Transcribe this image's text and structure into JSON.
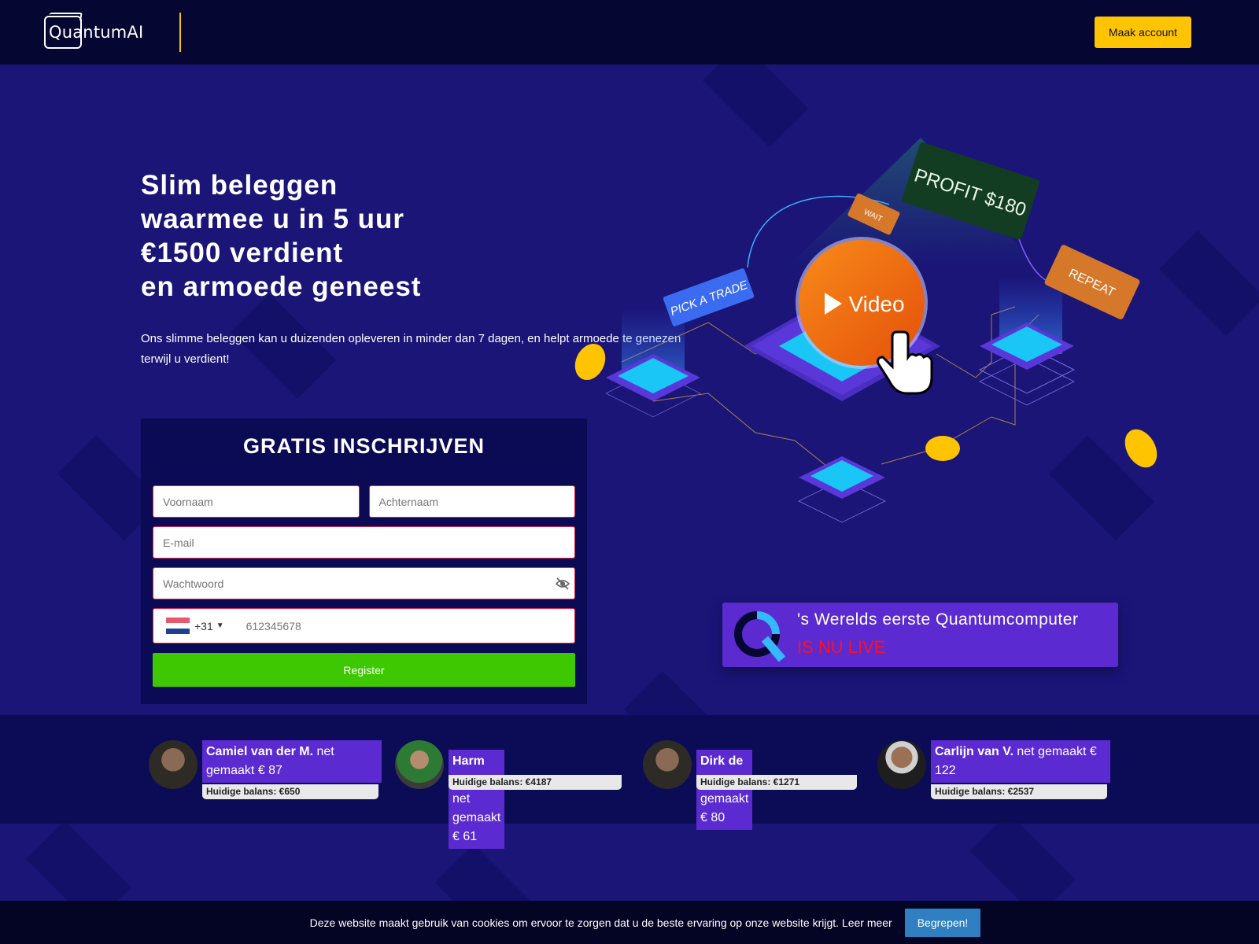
{
  "header": {
    "logo_text": "QuantumAI",
    "cta_label": "Maak account"
  },
  "hero": {
    "title_lines": [
      "Slim beleggen",
      "waarmee u in 5 uur",
      "€1500 verdient",
      "en armoede geneest"
    ],
    "subtitle": "Ons slimme beleggen kan u duizenden opleveren in minder dan 7 dagen, en helpt armoede te genezen terwijl u verdient!"
  },
  "illustration": {
    "video_label": "Video",
    "pick_label": "PICK A TRADE",
    "wait_label": "WAIT",
    "profit_label": "PROFIT $180",
    "repeat_label": "REPEAT"
  },
  "form": {
    "title": "GRATIS INSCHRIJVEN",
    "first_name_placeholder": "Voornaam",
    "last_name_placeholder": "Achternaam",
    "email_placeholder": "E-mail",
    "password_placeholder": "Wachtwoord",
    "phone_code": "+31",
    "phone_placeholder": "612345678",
    "submit_label": "Register"
  },
  "quantum_banner": {
    "line1": "'s Werelds eerste Quantumcomputer",
    "line2": "IS NU LIVE"
  },
  "testimonials": [
    {
      "name": "Camiel van der M.",
      "text": "net gemaakt € 87",
      "balance": "Huidige balans: €650"
    },
    {
      "name": "Harm van L.",
      "text": "net gemaakt € 61",
      "balance": "Huidige balans: €4187"
    },
    {
      "name": "Dirk de W.",
      "text": "net gemaakt € 80",
      "balance": "Huidige balans: €1271"
    },
    {
      "name": "Carlijn van V.",
      "text": "net gemaakt € 122",
      "balance": "Huidige balans: €2537"
    }
  ],
  "cookie": {
    "text": "Deze website maakt gebruik van cookies om ervoor te zorgen dat u de beste ervaring op onze website krijgt.",
    "link": "Leer meer",
    "button": "Begrepen!"
  },
  "colors": {
    "background": "#1a1577",
    "header": "#050631",
    "accent_yellow": "#ffc400",
    "register_green": "#3ec802",
    "purple": "#5b2bd1",
    "live_red": "#ff1020"
  }
}
